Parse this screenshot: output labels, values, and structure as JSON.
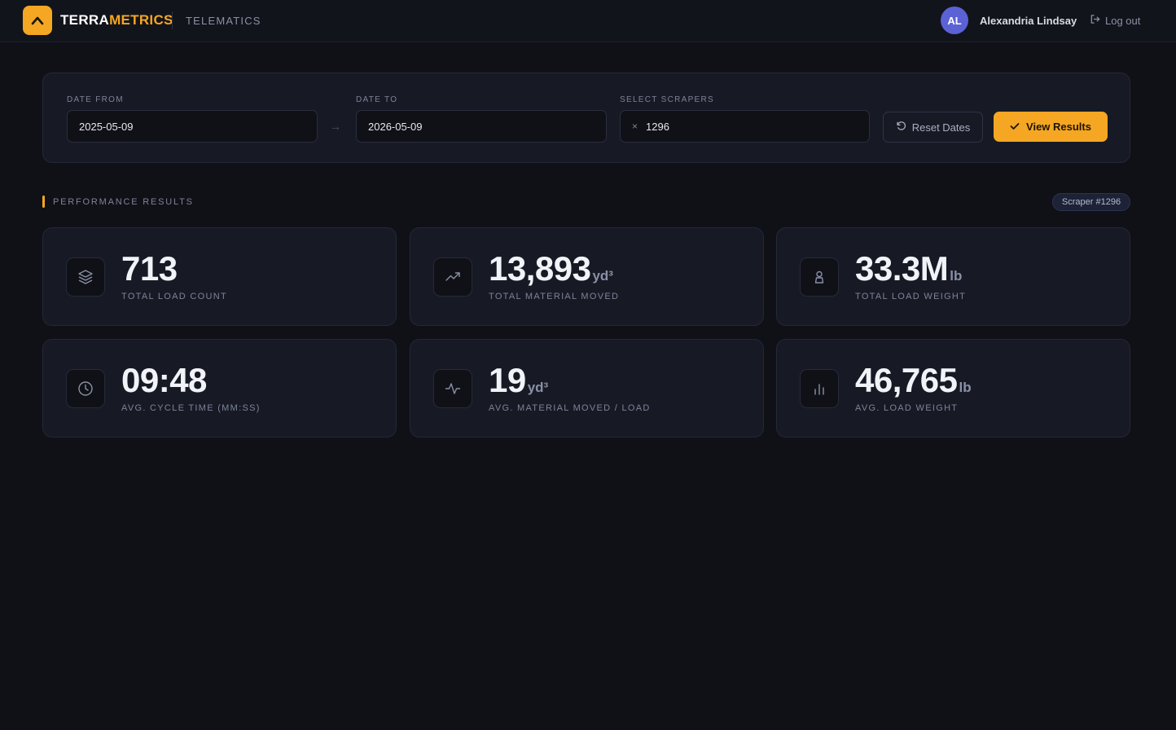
{
  "header": {
    "brand_part1": "TERRA",
    "brand_part2": "METRICS",
    "module": "TELEMATICS",
    "user_initials": "AL",
    "user_name": "Alexandria Lindsay",
    "logout_label": "Log out"
  },
  "filters": {
    "date_from_label": "DATE FROM",
    "date_from_value": "2025-05-09",
    "date_to_label": "DATE TO",
    "date_to_value": "2026-05-09",
    "scrapers_label": "SELECT SCRAPERS",
    "scraper_tag": "1296",
    "reset_label": "Reset Dates",
    "view_label": "View Results"
  },
  "section": {
    "title": "PERFORMANCE RESULTS",
    "badge": "Scraper #1296"
  },
  "metrics": [
    {
      "value": "713",
      "unit": "",
      "label": "TOTAL LOAD COUNT",
      "icon": "layers-icon"
    },
    {
      "value": "13,893",
      "unit": "yd³",
      "label": "TOTAL MATERIAL MOVED",
      "icon": "trending-up-icon"
    },
    {
      "value": "33.3M",
      "unit": "lb",
      "label": "TOTAL LOAD WEIGHT",
      "icon": "weight-icon"
    },
    {
      "value": "09:48",
      "unit": "",
      "label": "AVG. CYCLE TIME (MM:SS)",
      "icon": "clock-icon"
    },
    {
      "value": "19",
      "unit": "yd³",
      "label": "AVG. MATERIAL MOVED / LOAD",
      "icon": "activity-icon"
    },
    {
      "value": "46,765",
      "unit": "lb",
      "label": "AVG. LOAD WEIGHT",
      "icon": "bar-chart-icon"
    }
  ],
  "colors": {
    "accent": "#f5a623",
    "background": "#101117",
    "card": "#171a25",
    "avatar": "#5b62d6"
  }
}
